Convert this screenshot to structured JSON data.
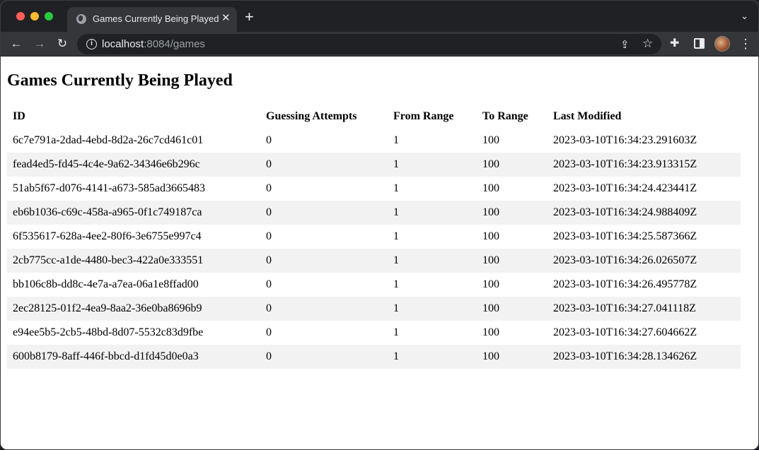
{
  "browser": {
    "tab_title": "Games Currently Being Played",
    "tab_close": "✕",
    "new_tab": "+",
    "url_host": "localhost",
    "url_rest": ":8084/games",
    "icons": [
      "back-arrow-icon",
      "forward-arrow-icon",
      "reload-icon",
      "info-icon",
      "share-icon",
      "star-icon",
      "extensions-icon",
      "side-panel-icon",
      "menu-icon"
    ]
  },
  "page": {
    "title": "Games Currently Being Played",
    "columns": [
      "ID",
      "Guessing Attempts",
      "From Range",
      "To Range",
      "Last Modified"
    ],
    "rows": [
      {
        "id": "6c7e791a-2dad-4ebd-8d2a-26c7cd461c01",
        "attempts": "0",
        "from": "1",
        "to": "100",
        "modified": "2023-03-10T16:34:23.291603Z"
      },
      {
        "id": "fead4ed5-fd45-4c4e-9a62-34346e6b296c",
        "attempts": "0",
        "from": "1",
        "to": "100",
        "modified": "2023-03-10T16:34:23.913315Z"
      },
      {
        "id": "51ab5f67-d076-4141-a673-585ad3665483",
        "attempts": "0",
        "from": "1",
        "to": "100",
        "modified": "2023-03-10T16:34:24.423441Z"
      },
      {
        "id": "eb6b1036-c69c-458a-a965-0f1c749187ca",
        "attempts": "0",
        "from": "1",
        "to": "100",
        "modified": "2023-03-10T16:34:24.988409Z"
      },
      {
        "id": "6f535617-628a-4ee2-80f6-3e6755e997c4",
        "attempts": "0",
        "from": "1",
        "to": "100",
        "modified": "2023-03-10T16:34:25.587366Z"
      },
      {
        "id": "2cb775cc-a1de-4480-bec3-422a0e333551",
        "attempts": "0",
        "from": "1",
        "to": "100",
        "modified": "2023-03-10T16:34:26.026507Z"
      },
      {
        "id": "bb106c8b-dd8c-4e7a-a7ea-06a1e8ffad00",
        "attempts": "0",
        "from": "1",
        "to": "100",
        "modified": "2023-03-10T16:34:26.495778Z"
      },
      {
        "id": "2ec28125-01f2-4ea9-8aa2-36e0ba8696b9",
        "attempts": "0",
        "from": "1",
        "to": "100",
        "modified": "2023-03-10T16:34:27.041118Z"
      },
      {
        "id": "e94ee5b5-2cb5-48bd-8d07-5532c83d9fbe",
        "attempts": "0",
        "from": "1",
        "to": "100",
        "modified": "2023-03-10T16:34:27.604662Z"
      },
      {
        "id": "600b8179-8aff-446f-bbcd-d1fd45d0e0a3",
        "attempts": "0",
        "from": "1",
        "to": "100",
        "modified": "2023-03-10T16:34:28.134626Z"
      }
    ]
  }
}
